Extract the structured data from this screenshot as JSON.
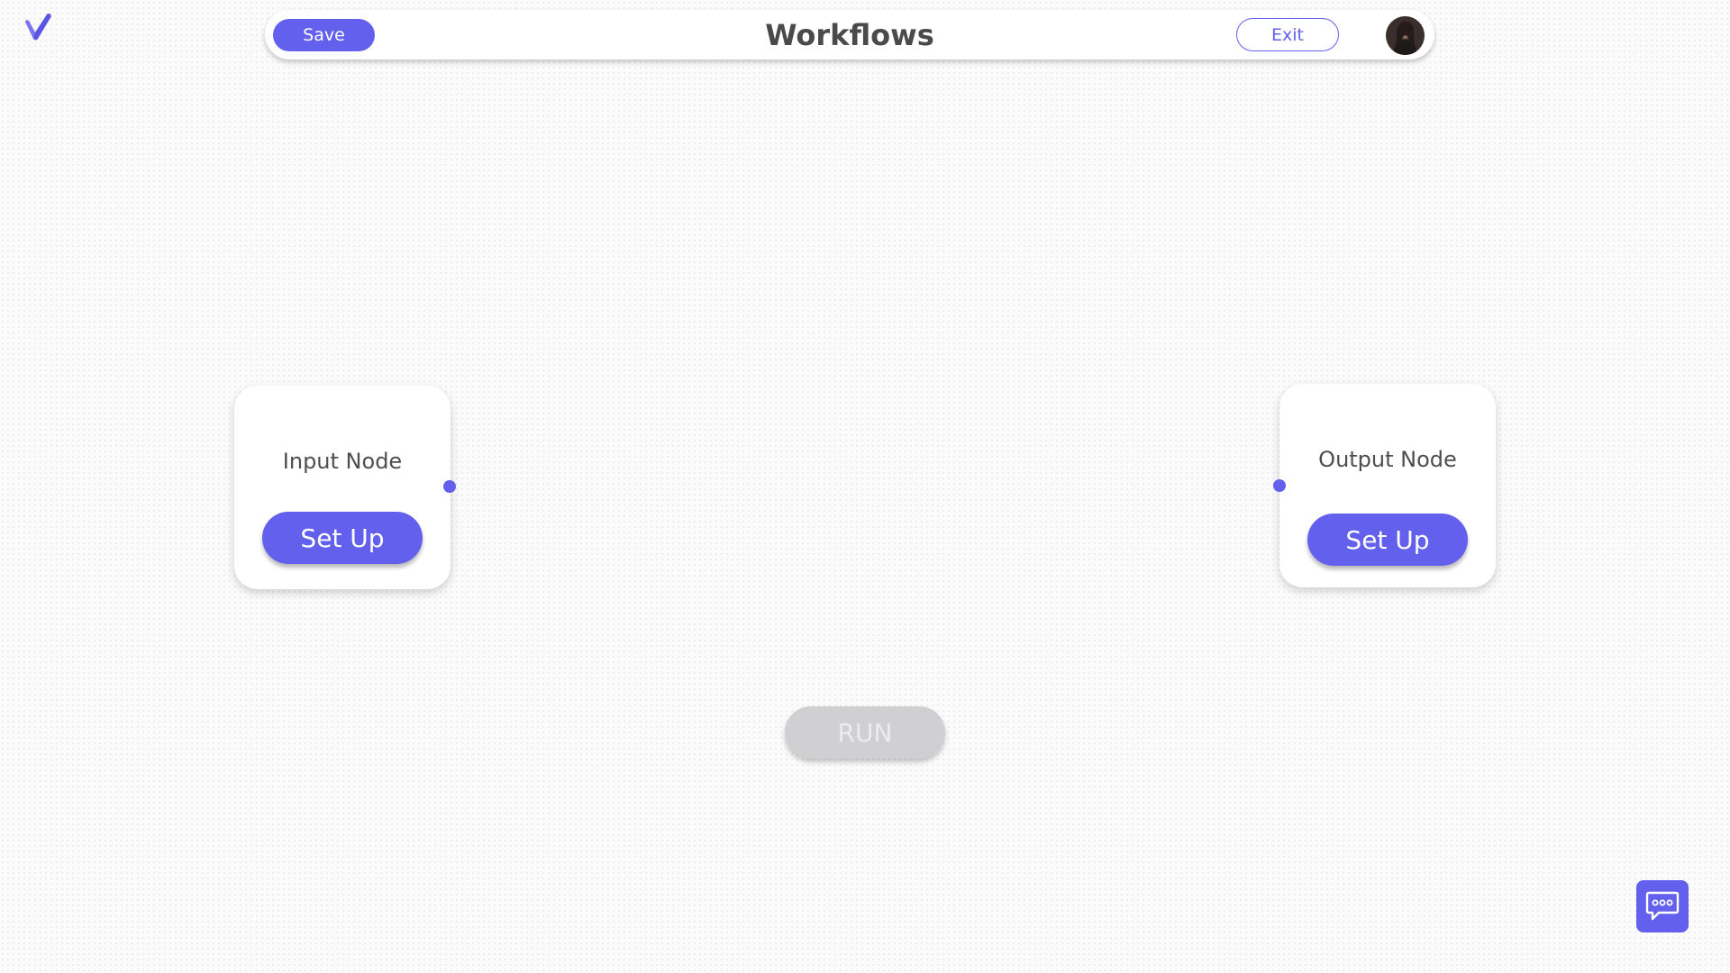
{
  "app": {
    "logo_icon": "check-v-logo",
    "brand_color": "#6260ec"
  },
  "header": {
    "title": "Workflows",
    "save_label": "Save",
    "exit_label": "Exit",
    "avatar_icon": "user-avatar"
  },
  "canvas": {
    "nodes": [
      {
        "label": "Input Node",
        "button_label": "Set Up",
        "port": "output-port"
      },
      {
        "label": "Output Node",
        "button_label": "Set Up",
        "port": "input-port"
      }
    ],
    "run_label": "RUN",
    "run_enabled": false
  },
  "chat": {
    "icon": "chat-bubble-icon"
  }
}
